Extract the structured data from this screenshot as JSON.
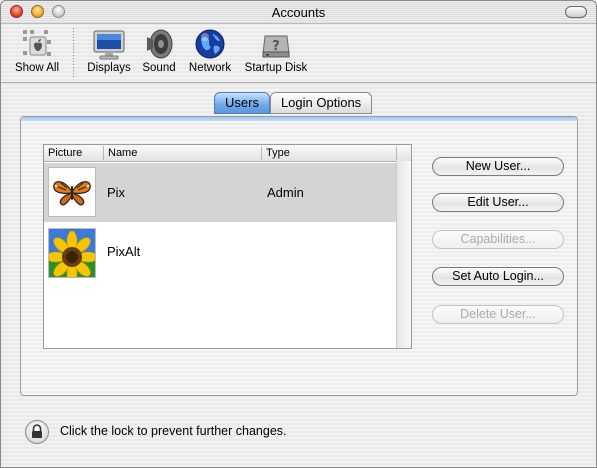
{
  "window": {
    "title": "Accounts"
  },
  "toolbar": {
    "items": [
      {
        "label": "Show All",
        "icon": "apple-show-all-icon"
      },
      {
        "label": "Displays",
        "icon": "display-icon"
      },
      {
        "label": "Sound",
        "icon": "speaker-icon"
      },
      {
        "label": "Network",
        "icon": "globe-icon"
      },
      {
        "label": "Startup Disk",
        "icon": "hard-disk-icon"
      }
    ]
  },
  "tabs": [
    {
      "label": "Users",
      "active": true
    },
    {
      "label": "Login Options",
      "active": false
    }
  ],
  "users_table": {
    "columns": [
      "Picture",
      "Name",
      "Type"
    ],
    "rows": [
      {
        "picture": "butterfly-picture",
        "name": "Pix",
        "type": "Admin",
        "selected": true
      },
      {
        "picture": "sunflower-picture",
        "name": "PixAlt",
        "type": "",
        "selected": false
      }
    ]
  },
  "buttons": {
    "new_user": {
      "label": "New User...",
      "enabled": true
    },
    "edit_user": {
      "label": "Edit User...",
      "enabled": true
    },
    "capabilities": {
      "label": "Capabilities...",
      "enabled": false
    },
    "set_auto_login": {
      "label": "Set Auto Login...",
      "enabled": true
    },
    "delete_user": {
      "label": "Delete User...",
      "enabled": false
    }
  },
  "footer": {
    "lock_text": "Click the lock to prevent further changes."
  },
  "colors": {
    "selected_row": "#d4d4d4",
    "active_tab": "#6fa7e8"
  }
}
